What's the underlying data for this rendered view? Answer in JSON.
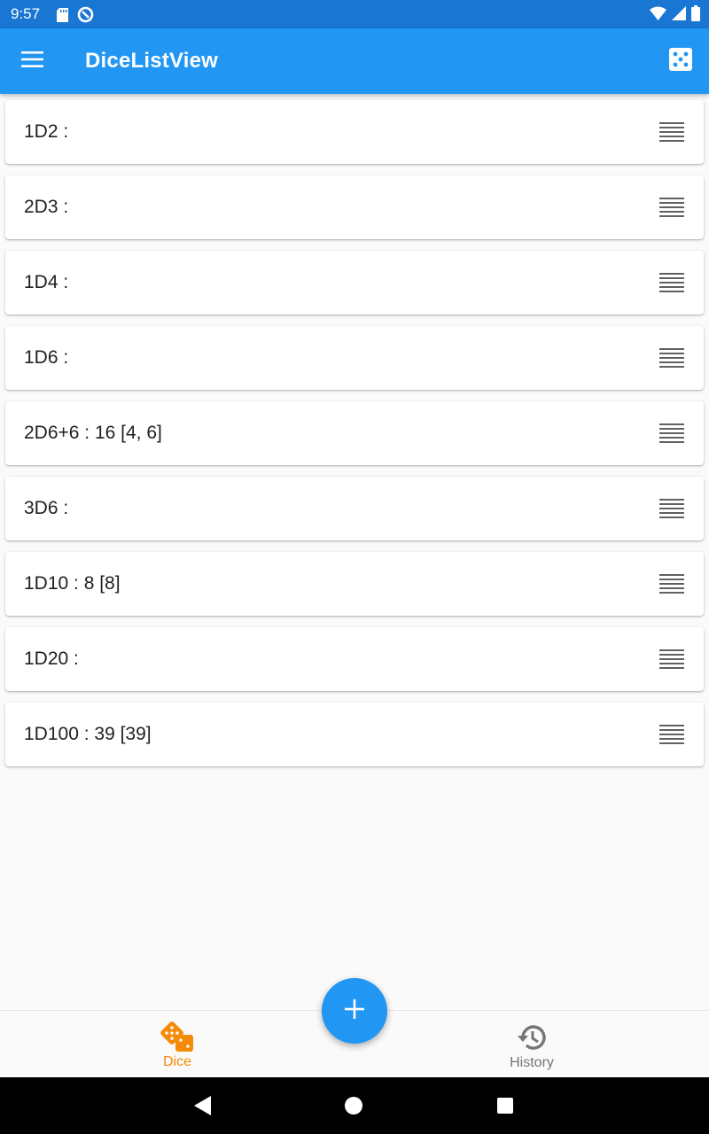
{
  "status_bar": {
    "time": "9:57",
    "left_icons": [
      "sd-card-icon",
      "sync-icon"
    ],
    "right_icons": [
      "wifi-icon",
      "signal-icon",
      "battery-icon"
    ]
  },
  "app_bar": {
    "title": "DiceListView",
    "menu_icon": "menu-icon",
    "action_icon": "dice-icon",
    "color": "#2196f3"
  },
  "dice_list": [
    {
      "label": "1D2 :"
    },
    {
      "label": "2D3 :"
    },
    {
      "label": "1D4 :"
    },
    {
      "label": "1D6 :"
    },
    {
      "label": "2D6+6 : 16 [4, 6]"
    },
    {
      "label": "3D6 :"
    },
    {
      "label": "1D10 : 8 [8]"
    },
    {
      "label": "1D20 :"
    },
    {
      "label": "1D100 : 39 [39]"
    }
  ],
  "fab": {
    "icon": "plus-icon",
    "color": "#2196f3"
  },
  "bottom_nav": {
    "items": [
      {
        "label": "Dice",
        "icon": "dice-icon",
        "active": true,
        "color": "#f58a07"
      },
      {
        "label": "History",
        "icon": "history-icon",
        "active": false,
        "color": "#757575"
      }
    ]
  },
  "system_nav": [
    "back-icon",
    "home-icon",
    "recents-icon"
  ]
}
